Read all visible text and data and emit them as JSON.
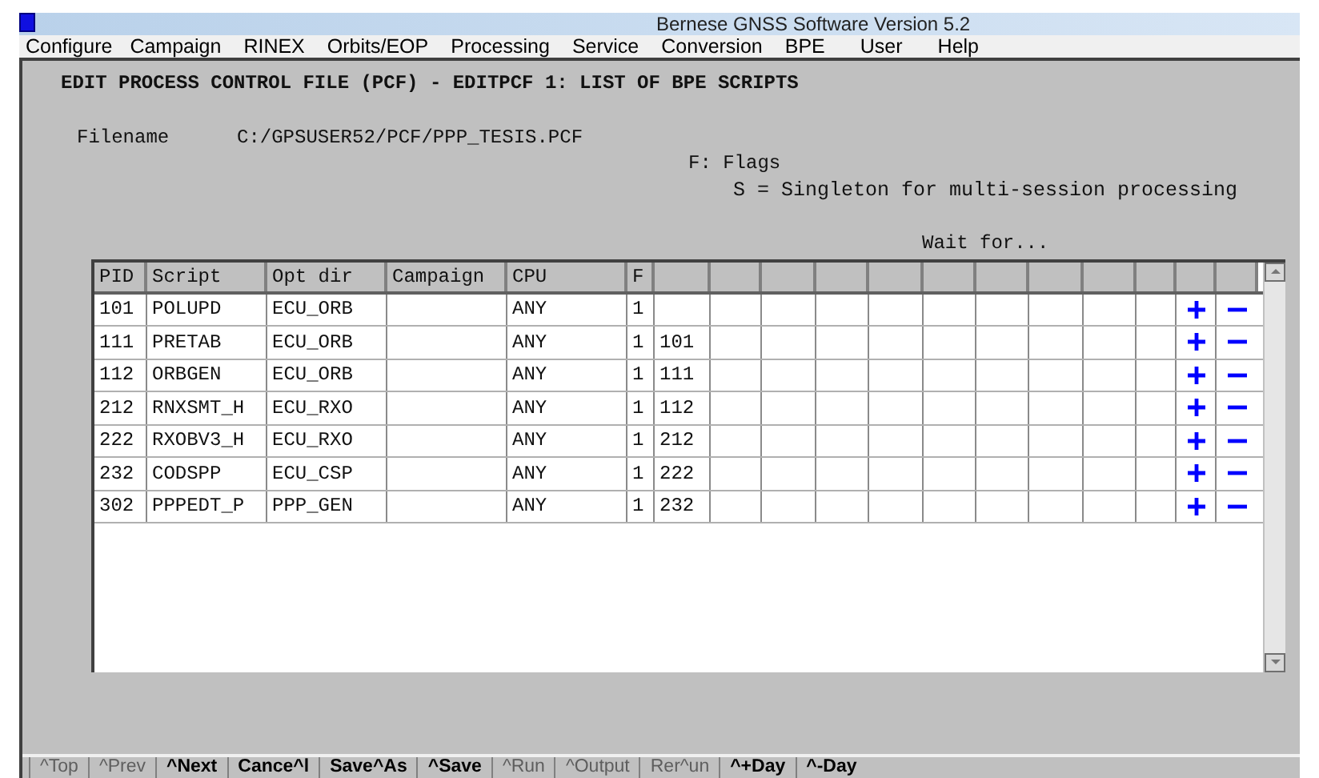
{
  "window": {
    "title": "Bernese GNSS Software Version 5.2"
  },
  "menu": [
    "Configure",
    "Campaign",
    "RINEX",
    "Orbits/EOP",
    "Processing",
    "Service",
    "Conversion",
    "BPE",
    "User",
    "Help"
  ],
  "panel_title": "EDIT PROCESS CONTROL FILE (PCF) - EDITPCF 1: LIST OF BPE SCRIPTS",
  "filename": {
    "label": "Filename",
    "value": "C:/GPSUSER52/PCF/PPP_TESIS.PCF"
  },
  "legend": [
    "F: Flags",
    "S = Singleton for multi-session processing"
  ],
  "wait_for_label": "Wait for...",
  "table": {
    "columns": [
      "PID",
      "Script",
      "Opt dir",
      "Campaign",
      "CPU",
      "F"
    ],
    "rows": [
      {
        "pid": "101",
        "script": "POLUPD",
        "opt_dir": "ECU_ORB",
        "cpu": "ANY",
        "flag": "1",
        "wait_for": []
      },
      {
        "pid": "111",
        "script": "PRETAB",
        "opt_dir": "ECU_ORB",
        "cpu": "ANY",
        "flag": "1",
        "wait_for": [
          "101"
        ]
      },
      {
        "pid": "112",
        "script": "ORBGEN",
        "opt_dir": "ECU_ORB",
        "cpu": "ANY",
        "flag": "1",
        "wait_for": [
          "111"
        ]
      },
      {
        "pid": "212",
        "script": "RNXSMT_H",
        "opt_dir": "ECU_RXO",
        "cpu": "ANY",
        "flag": "1",
        "wait_for": [
          "112"
        ]
      },
      {
        "pid": "222",
        "script": "RXOBV3_H",
        "opt_dir": "ECU_RXO",
        "cpu": "ANY",
        "flag": "1",
        "wait_for": [
          "212"
        ]
      },
      {
        "pid": "232",
        "script": "CODSPP",
        "opt_dir": "ECU_CSP",
        "cpu": "ANY",
        "flag": "1",
        "wait_for": [
          "222"
        ]
      },
      {
        "pid": "302",
        "script": "PPPEDT_P",
        "opt_dir": "PPP_GEN",
        "cpu": "ANY",
        "flag": "1",
        "wait_for": [
          "232"
        ]
      }
    ]
  },
  "buttons": [
    {
      "label": "^Top",
      "disabled": true
    },
    {
      "label": "^Prev",
      "disabled": true
    },
    {
      "label": "^Next",
      "disabled": false
    },
    {
      "label": "Cance^l",
      "disabled": false
    },
    {
      "label": "Save^As",
      "disabled": false
    },
    {
      "label": "^Save",
      "disabled": false
    },
    {
      "label": "^Run",
      "disabled": true
    },
    {
      "label": "^Output",
      "disabled": true
    },
    {
      "label": "Rer^un",
      "disabled": true
    },
    {
      "label": "^+Day",
      "disabled": false
    },
    {
      "label": "^-Day",
      "disabled": false
    }
  ]
}
